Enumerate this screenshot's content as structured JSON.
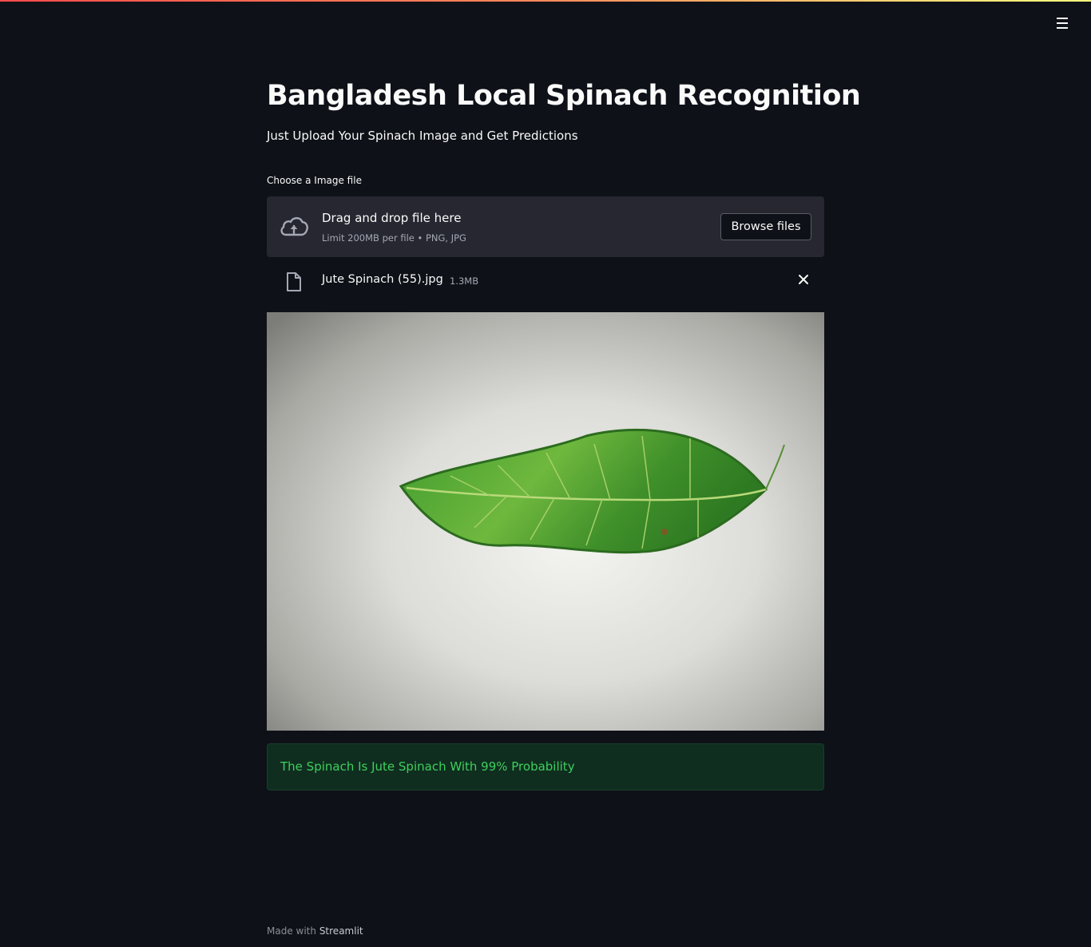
{
  "header": {
    "menu_icon": "hamburger-menu-icon"
  },
  "main": {
    "title": "Bangladesh Local Spinach Recognition",
    "subtitle": "Just Upload Your Spinach Image and Get Predictions"
  },
  "uploader": {
    "label": "Choose a Image file",
    "icon": "cloud-upload-icon",
    "drop_text": "Drag and drop file here",
    "limit_text": "Limit 200MB per file • PNG, JPG",
    "browse_label": "Browse files"
  },
  "uploaded_file": {
    "icon": "file-icon",
    "name": "Jute Spinach (55).jpg",
    "size": "1.3MB",
    "remove_icon": "close-icon"
  },
  "preview": {
    "subject": "green jute spinach leaf on white paper"
  },
  "result": {
    "message": "The Spinach Is Jute Spinach With 99% Probability",
    "status_color": "#3ecf5e"
  },
  "footer": {
    "prefix": "Made with",
    "brand": "Streamlit"
  },
  "colors": {
    "background": "#0e1117",
    "panel": "#262730",
    "success_bg": "#0f2e1f"
  }
}
